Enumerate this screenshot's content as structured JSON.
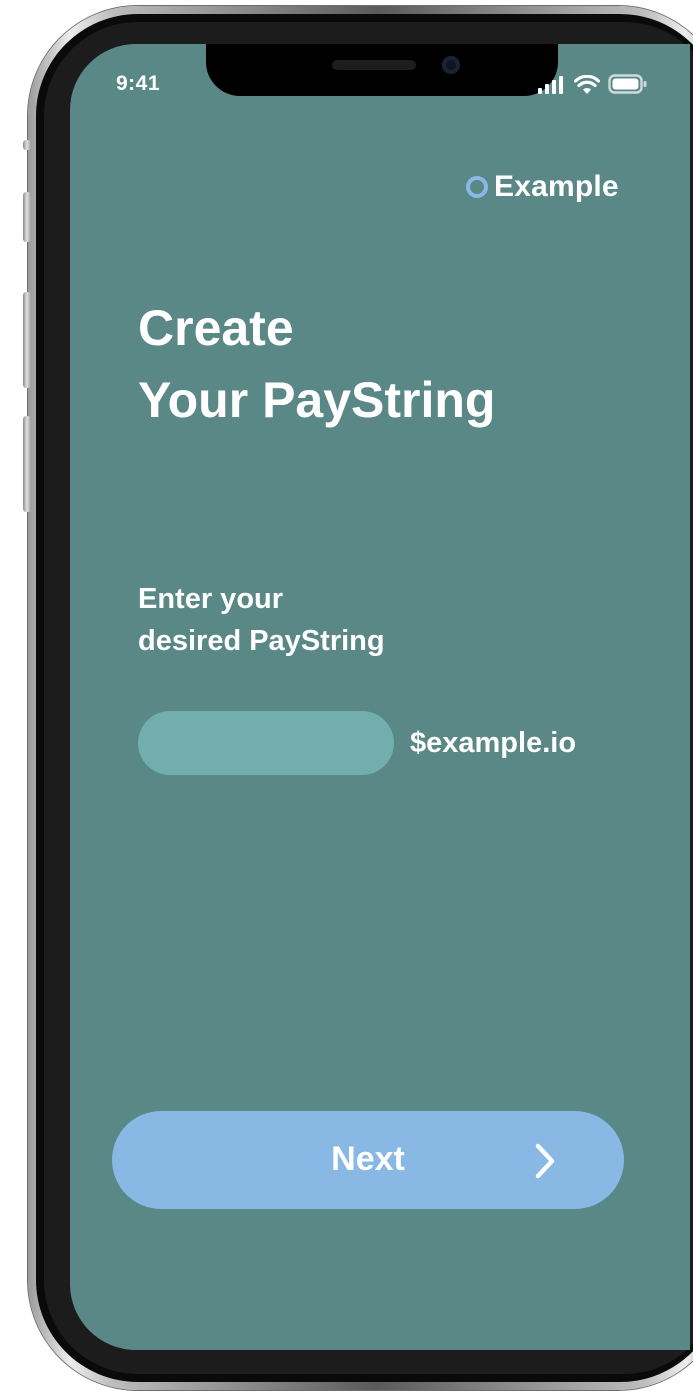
{
  "status_bar": {
    "time": "9:41",
    "icons": [
      "signal-icon",
      "wifi-icon",
      "battery-icon"
    ]
  },
  "brand": {
    "name": "Example",
    "ring_color": "#8ab8e6"
  },
  "screen": {
    "background": "#5a8886",
    "title_line_1": "Create",
    "title_line_2": "Your PayString",
    "prompt_line_1": "Enter your",
    "prompt_line_2": "desired PayString"
  },
  "paystring_input": {
    "value": "",
    "placeholder": "",
    "suffix": "$example.io",
    "fill_color": "#72aeac"
  },
  "next_button": {
    "label": "Next",
    "icon": "chevron-right-icon",
    "color": "#89b8e5"
  }
}
